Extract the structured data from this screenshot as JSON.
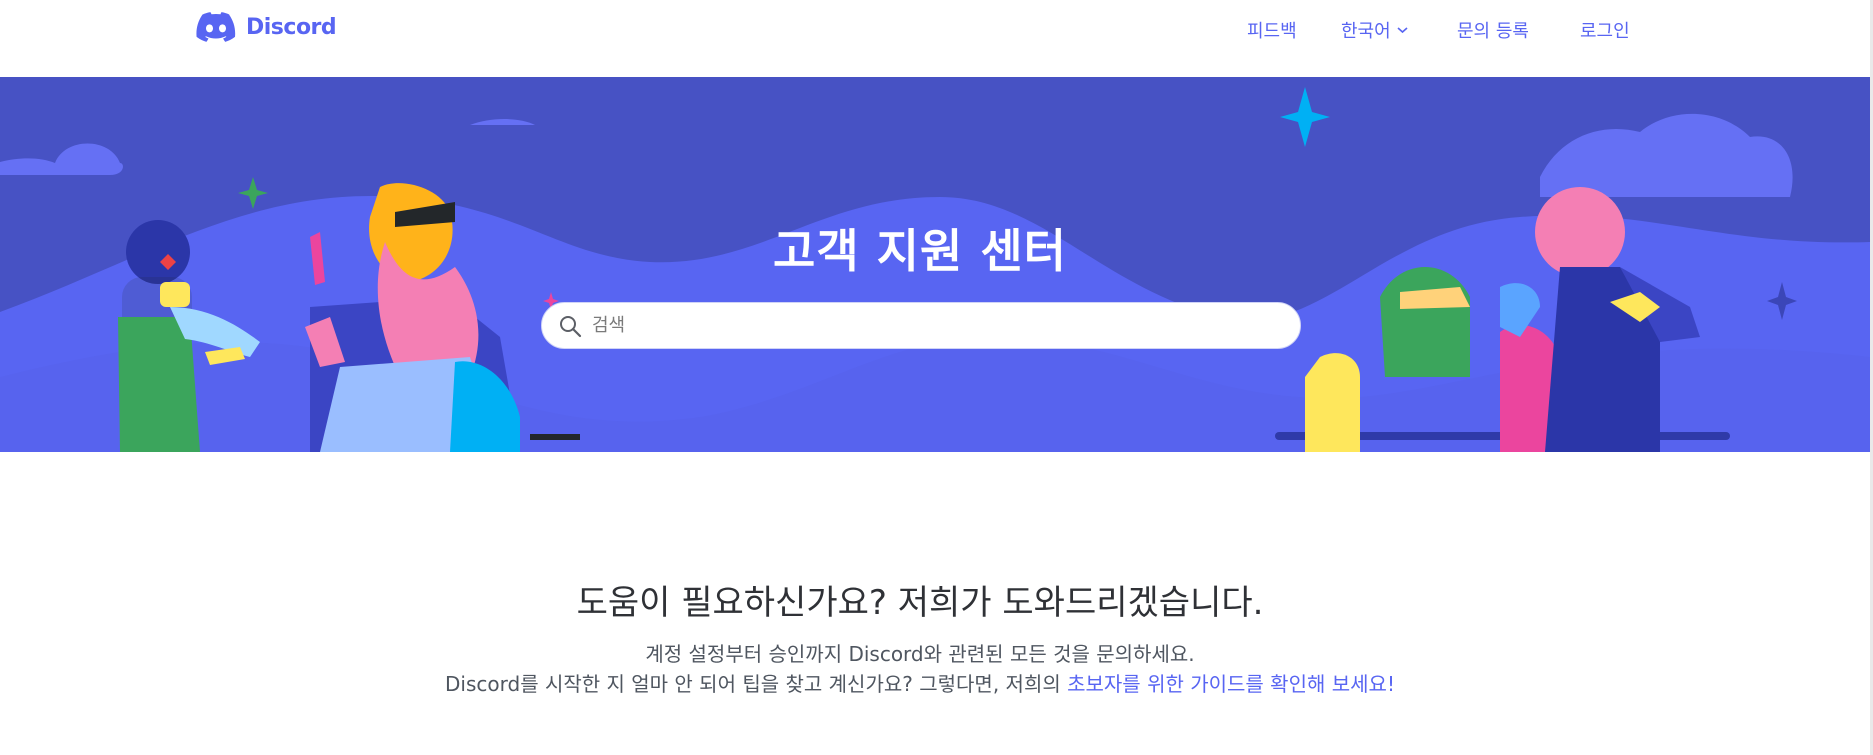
{
  "header": {
    "brand": "Discord",
    "nav": [
      {
        "label": "피드백"
      },
      {
        "label": "한국어",
        "has_dropdown": true
      },
      {
        "label": "문의 등록"
      },
      {
        "label": "로그인"
      }
    ]
  },
  "hero": {
    "title": "고객 지원 센터",
    "search_placeholder": "검색",
    "background_color": "#4752C4",
    "accent_color": "#5865F2"
  },
  "main": {
    "headline": "도움이 필요하신가요? 저희가 도와드리겠습니다.",
    "line1": "계정 설정부터 승인까지 Discord와 관련된 모든 것을 문의하세요.",
    "line2_prefix": "Discord를 시작한 지 얼마 안 되어 팁을 찾고 계신가요? 그렇다면, 저희의 ",
    "line2_link": "초보자를 위한 가이드를 확인해 보세요!"
  }
}
